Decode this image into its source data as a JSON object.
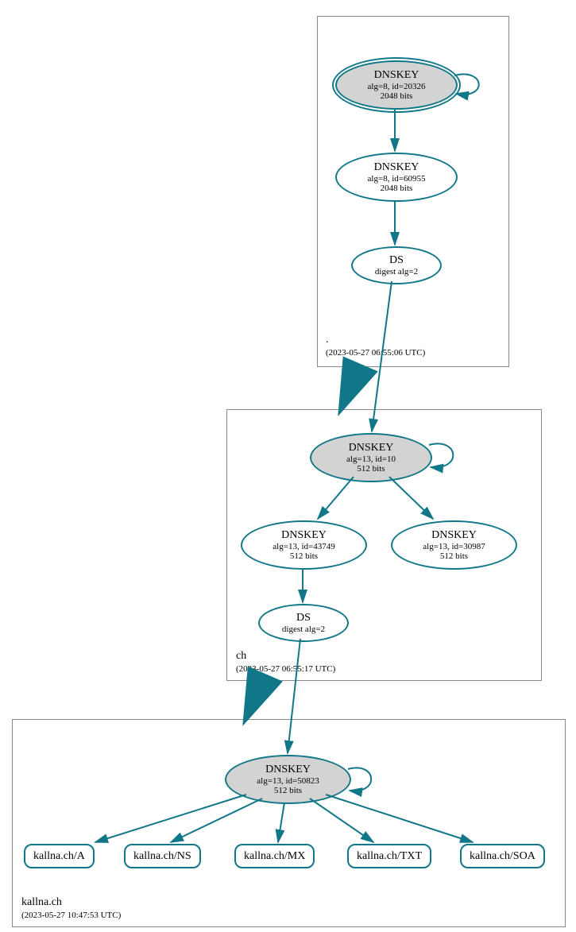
{
  "zones": {
    "root": {
      "name": ".",
      "timestamp": "(2023-05-27 06:55:06 UTC)"
    },
    "ch": {
      "name": "ch",
      "timestamp": "(2023-05-27 06:55:17 UTC)"
    },
    "leaf": {
      "name": "kallna.ch",
      "timestamp": "(2023-05-27 10:47:53 UTC)"
    }
  },
  "nodes": {
    "root_ksk": {
      "title": "DNSKEY",
      "l1": "alg=8, id=20326",
      "l2": "2048 bits"
    },
    "root_zsk": {
      "title": "DNSKEY",
      "l1": "alg=8, id=60955",
      "l2": "2048 bits"
    },
    "root_ds": {
      "title": "DS",
      "l1": "digest alg=2"
    },
    "ch_ksk": {
      "title": "DNSKEY",
      "l1": "alg=13, id=10",
      "l2": "512 bits"
    },
    "ch_zsk": {
      "title": "DNSKEY",
      "l1": "alg=13, id=43749",
      "l2": "512 bits"
    },
    "ch_zsk2": {
      "title": "DNSKEY",
      "l1": "alg=13, id=30987",
      "l2": "512 bits"
    },
    "ch_ds": {
      "title": "DS",
      "l1": "digest alg=2"
    },
    "leaf_ksk": {
      "title": "DNSKEY",
      "l1": "alg=13, id=50823",
      "l2": "512 bits"
    },
    "rr_a": {
      "label": "kallna.ch/A"
    },
    "rr_ns": {
      "label": "kallna.ch/NS"
    },
    "rr_mx": {
      "label": "kallna.ch/MX"
    },
    "rr_txt": {
      "label": "kallna.ch/TXT"
    },
    "rr_soa": {
      "label": "kallna.ch/SOA"
    }
  },
  "colors": {
    "stroke": "#117788"
  }
}
